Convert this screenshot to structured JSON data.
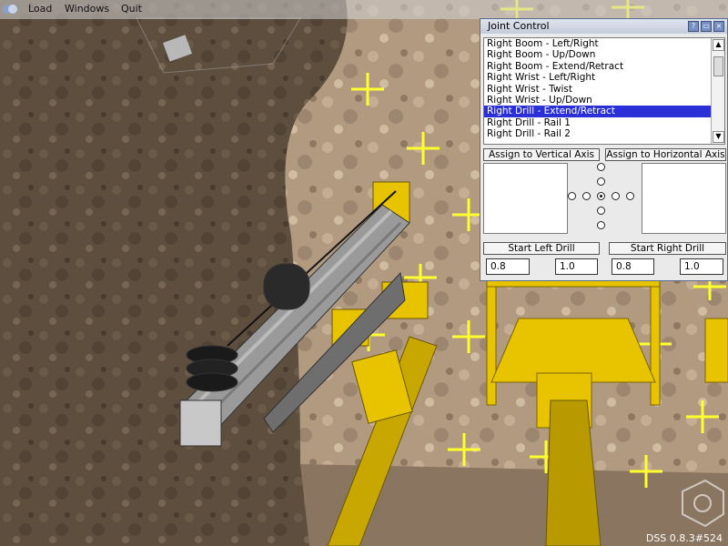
{
  "menu": {
    "items": [
      "Load",
      "Windows",
      "Quit"
    ]
  },
  "joint_control": {
    "title": "Joint Control",
    "joints": [
      "Right Boom - Left/Right",
      "Right Boom - Up/Down",
      "Right Boom - Extend/Retract",
      "Right Wrist - Left/Right",
      "Right Wrist - Twist",
      "Right Wrist - Up/Down",
      "Right Drill - Extend/Retract",
      "Right Drill - Rail 1",
      "Right Drill - Rail 2"
    ],
    "selected_index": 6,
    "assign_vertical_label": "Assign to Vertical Axis",
    "assign_horizontal_label": "Assign to Horizontal Axis",
    "start_left_label": "Start Left Drill",
    "start_right_label": "Start Right Drill",
    "left_drill_values": [
      "0.8",
      "1.0"
    ],
    "right_drill_values": [
      "0.8",
      "1.0"
    ]
  },
  "status": {
    "version": "DSS 0.8.3#524"
  },
  "colors": {
    "selection": "#2a2fd6",
    "machine_yellow": "#e8c400",
    "marker_yellow": "#ffff30"
  }
}
